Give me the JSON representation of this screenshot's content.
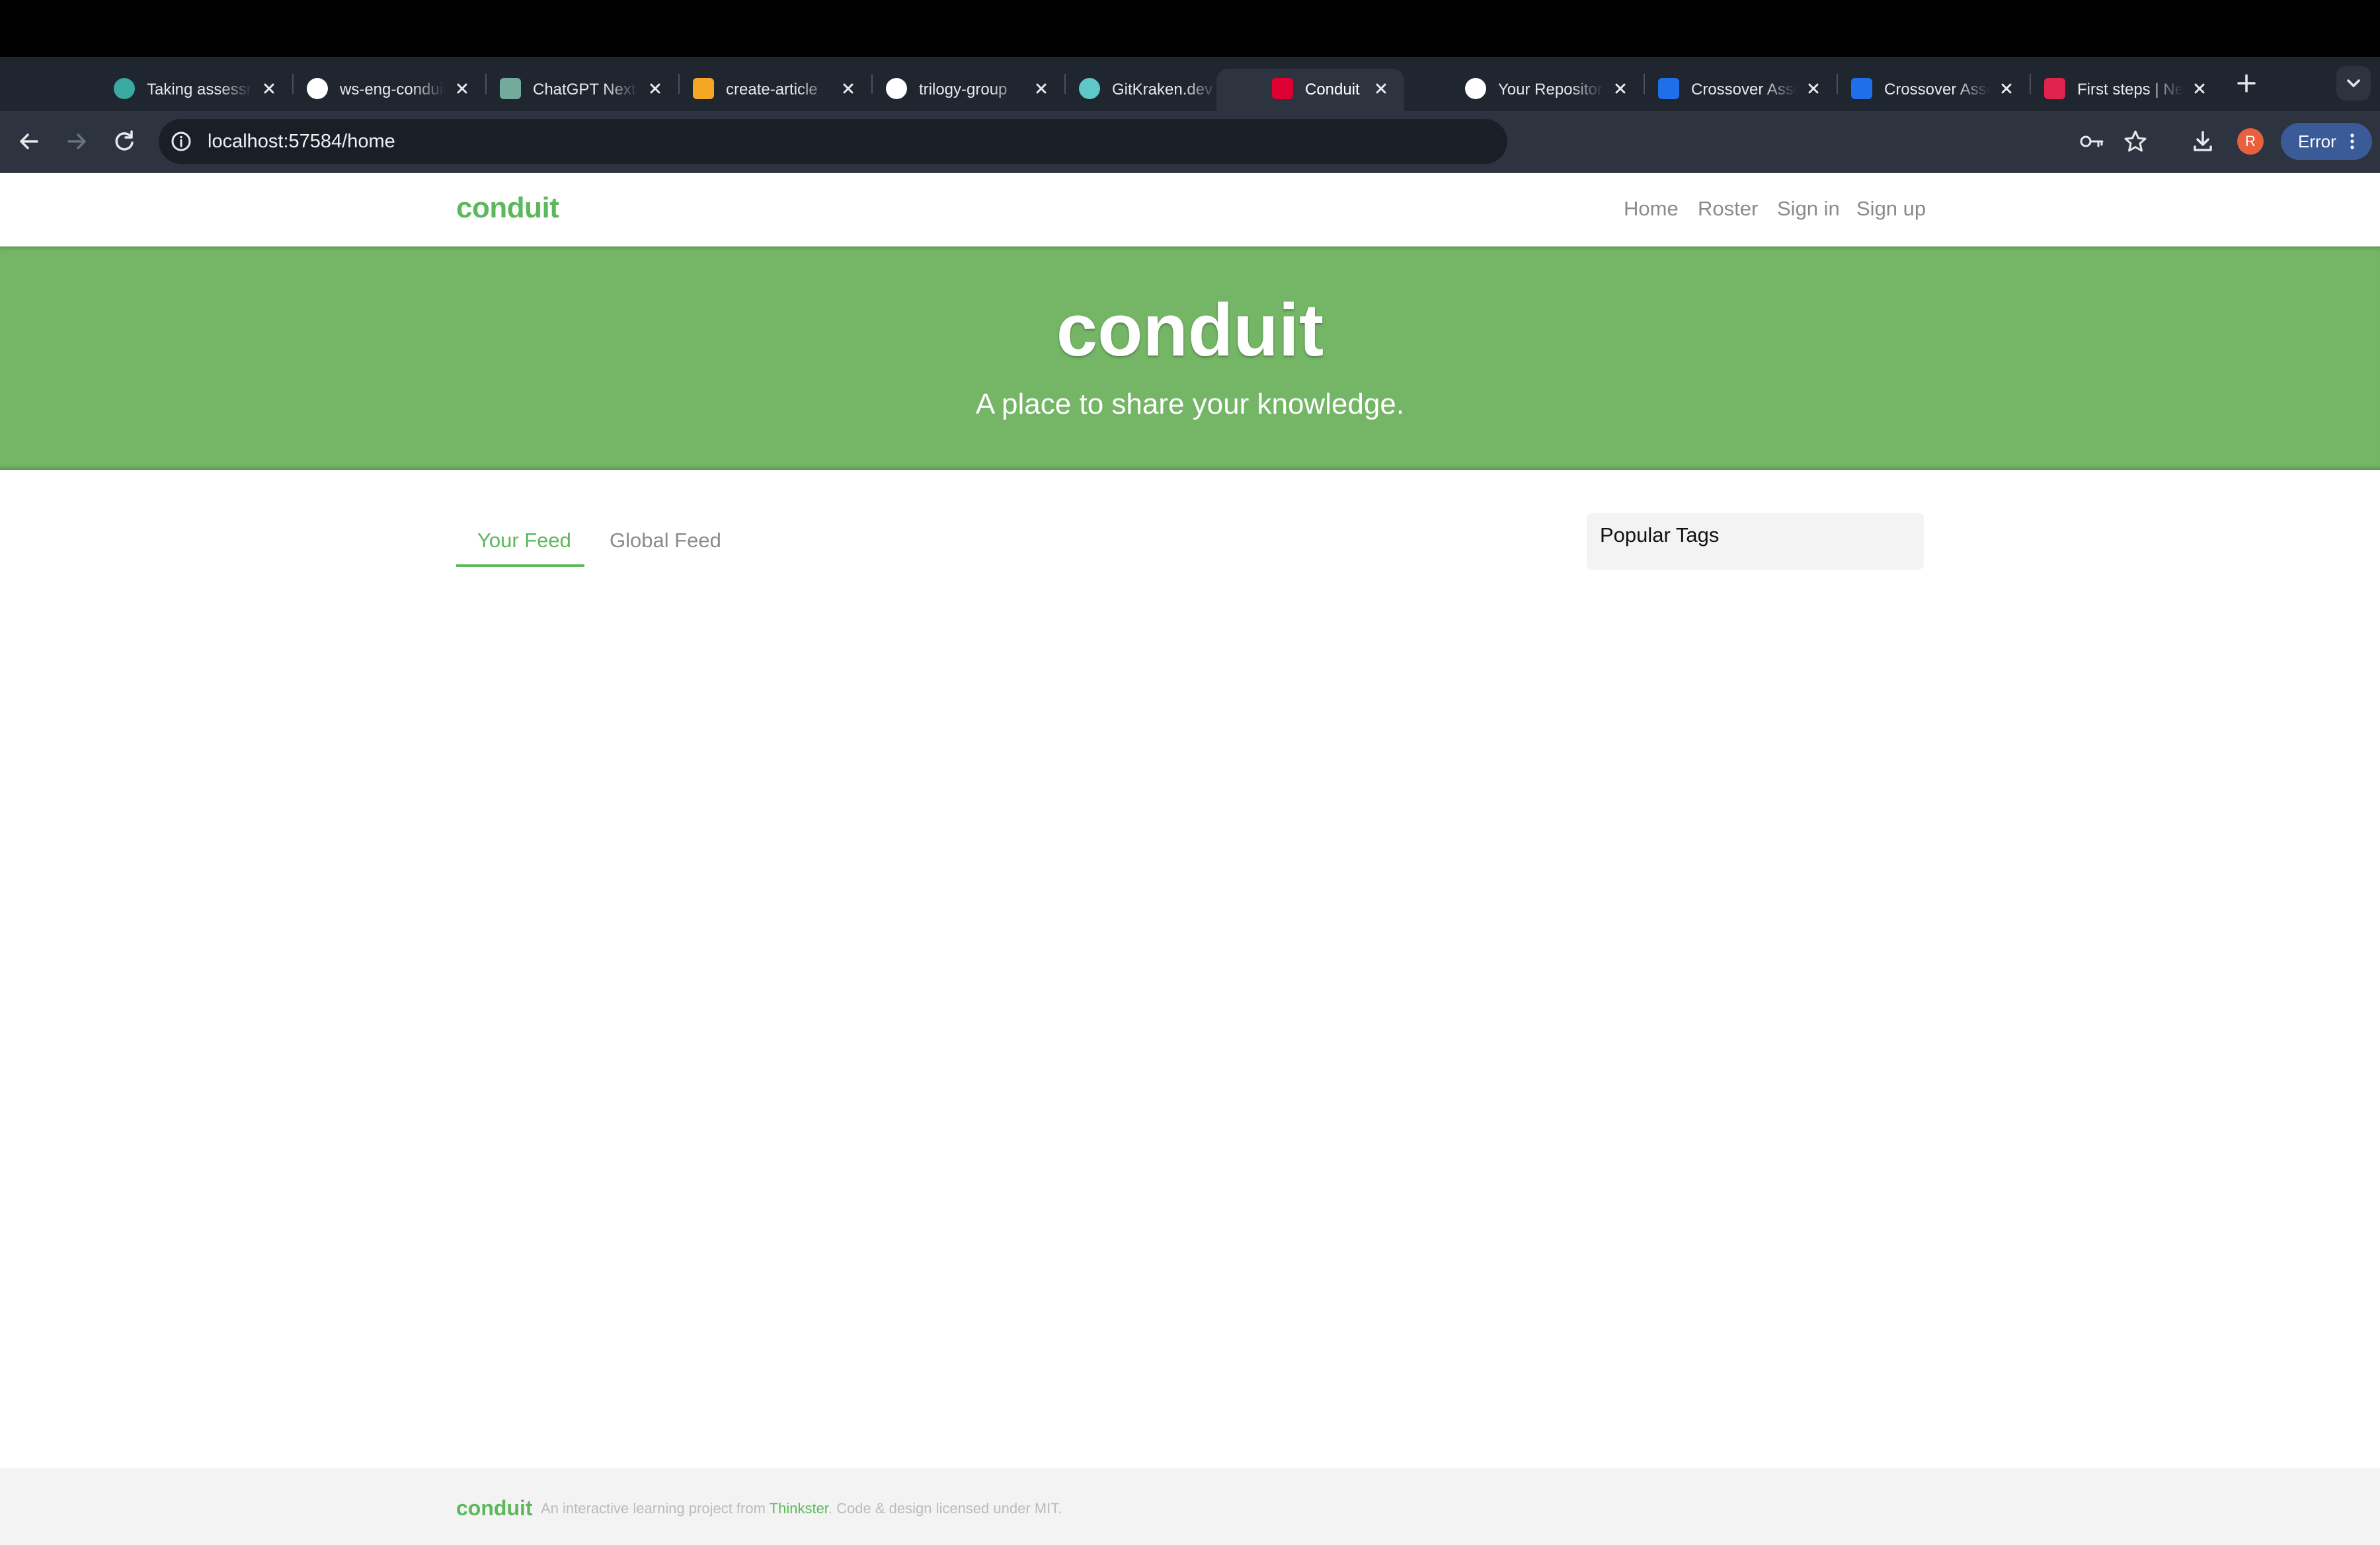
{
  "browser": {
    "tabs": [
      {
        "title": "Taking assessment",
        "icon": "assessment-icon",
        "active": false
      },
      {
        "title": "ws-eng-conduit",
        "icon": "github-icon",
        "active": false
      },
      {
        "title": "ChatGPT Next",
        "icon": "chatgpt-icon",
        "active": false
      },
      {
        "title": "create-article",
        "icon": "brand-orange-icon",
        "active": false
      },
      {
        "title": "trilogy-group",
        "icon": "github-icon",
        "active": false
      },
      {
        "title": "GitKraken.dev",
        "icon": "gitkraken-icon",
        "active": false
      },
      {
        "title": "Conduit",
        "icon": "angular-icon",
        "active": true
      },
      {
        "title": "Your Repositories",
        "icon": "github-icon",
        "active": false
      },
      {
        "title": "Crossover Assessment",
        "icon": "crossover-icon",
        "active": false
      },
      {
        "title": "Crossover Assessment",
        "icon": "crossover-icon",
        "active": false
      },
      {
        "title": "First steps | NestJS",
        "icon": "nestjs-icon",
        "active": false
      }
    ],
    "url": "localhost:57584/home",
    "profile_initial": "R",
    "error_label": "Error"
  },
  "navbar": {
    "brand": "conduit",
    "links": [
      "Home",
      "Roster",
      "Sign in",
      "Sign up"
    ]
  },
  "banner": {
    "title": "conduit",
    "subtitle": "A place to share your knowledge."
  },
  "feed": {
    "tabs": [
      "Your Feed",
      "Global Feed"
    ],
    "active_tab": "Your Feed"
  },
  "sidebar": {
    "tags_title": "Popular Tags"
  },
  "footer": {
    "brand": "conduit",
    "text_before": "An interactive learning project from",
    "link": "Thinkster",
    "text_after": ". Code & design licensed under MIT."
  },
  "colors": {
    "brand_green": "#5cb85c",
    "banner_green": "#74b566",
    "chrome_dark": "#1f2630",
    "error_pill": "#3a5b97"
  }
}
